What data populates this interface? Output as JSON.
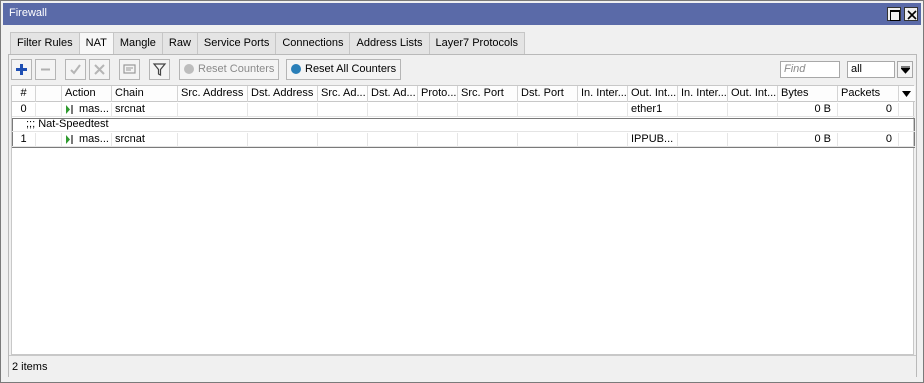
{
  "window": {
    "title": "Firewall"
  },
  "tabs": [
    {
      "label": "Filter Rules",
      "active": false
    },
    {
      "label": "NAT",
      "active": true
    },
    {
      "label": "Mangle",
      "active": false
    },
    {
      "label": "Raw",
      "active": false
    },
    {
      "label": "Service Ports",
      "active": false
    },
    {
      "label": "Connections",
      "active": false
    },
    {
      "label": "Address Lists",
      "active": false
    },
    {
      "label": "Layer7 Protocols",
      "active": false
    }
  ],
  "toolbar": {
    "icons": [
      "add-icon",
      "remove-icon",
      "enable-icon",
      "disable-icon",
      "comment-icon",
      "filter-icon"
    ],
    "reset_counters": "Reset Counters",
    "reset_all_counters": "Reset All Counters",
    "find_placeholder": "Find",
    "scope_value": "all"
  },
  "table": {
    "headers": [
      "#",
      "",
      "Action",
      "Chain",
      "Src. Address",
      "Dst. Address",
      "Src. Ad...",
      "Dst. Ad...",
      "Proto...",
      "Src. Port",
      "Dst. Port",
      "In. Inter...",
      "Out. Int...",
      "In. Inter...",
      "Out. Int...",
      "Bytes",
      "Packets"
    ],
    "rows": [
      {
        "num": "0",
        "action": "mas...",
        "chain": "srcnat",
        "out_interface": "ether1",
        "bytes": "0 B",
        "packets": "0"
      },
      {
        "num": "1",
        "action": "mas...",
        "chain": "srcnat",
        "out_interface": "IPPUB...",
        "bytes": "0 B",
        "packets": "0",
        "comment": ";;; Nat-Speedtest"
      }
    ]
  },
  "status": {
    "items": "2 items"
  },
  "colors": {
    "titlebar": "#5a6aa8",
    "add": "#1f4fb3",
    "reset_icon": "#2a7fb8",
    "action_icon": "#2e9a2e"
  }
}
